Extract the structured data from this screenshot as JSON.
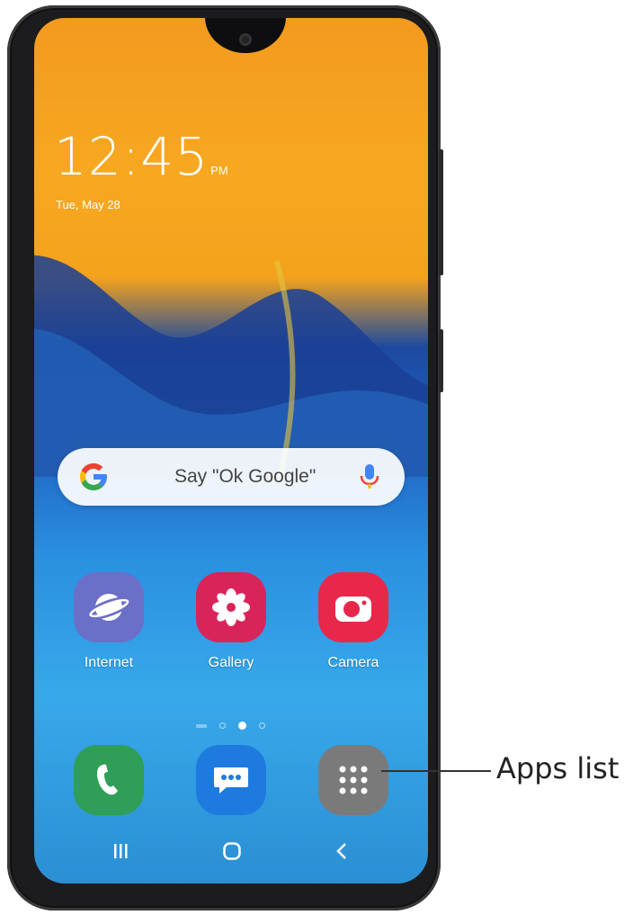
{
  "status": {
    "time": "12:45",
    "ampm": "PM",
    "date": "Tue, May 28"
  },
  "search": {
    "placeholder": "Say \"Ok Google\"",
    "left_icon": "google-g-icon",
    "right_icon": "mic-icon"
  },
  "apps": [
    {
      "label": "Internet",
      "icon": "internet-icon",
      "color": "#6b6fc7"
    },
    {
      "label": "Gallery",
      "icon": "gallery-icon",
      "color": "#d9245a"
    },
    {
      "label": "Camera",
      "icon": "camera-icon",
      "color": "#e8284a"
    }
  ],
  "dock": [
    {
      "icon": "phone-icon",
      "color": "#2f9e57"
    },
    {
      "icon": "messages-icon",
      "color": "#1f7ae0"
    },
    {
      "icon": "apps-list-icon",
      "color": "#7a7a7a"
    }
  ],
  "navbar": {
    "recent": "recent-apps-icon",
    "home": "home-icon",
    "back": "back-icon"
  },
  "callout": {
    "label": "Apps list"
  }
}
